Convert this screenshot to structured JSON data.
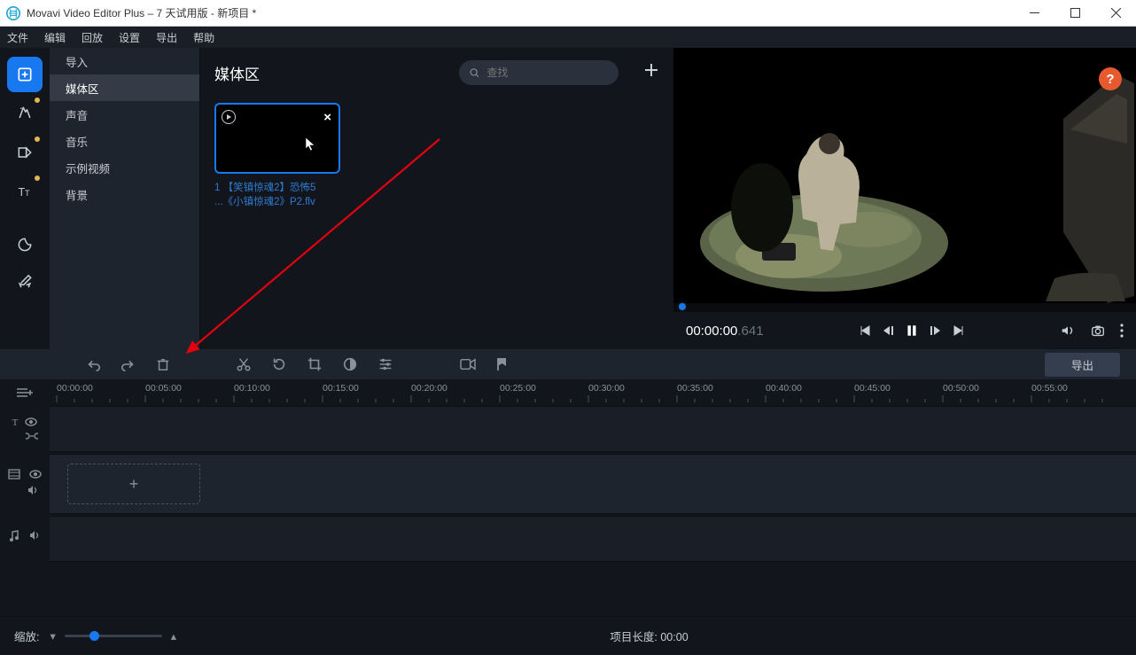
{
  "window": {
    "title": "Movavi Video Editor Plus – 7 天试用版 - 新项目 *"
  },
  "menu": {
    "file": "文件",
    "edit": "编辑",
    "playback": "回放",
    "settings": "设置",
    "export": "导出",
    "help": "帮助"
  },
  "side": {
    "import": "导入",
    "media": "媒体区",
    "sound": "声音",
    "music": "音乐",
    "sample": "示例视频",
    "bg": "背景"
  },
  "media": {
    "title": "媒体区",
    "search_placeholder": "查找",
    "clip_line1": "1 【笑镇惊魂2】恐怖5",
    "clip_line2": "...《小镇惊魂2》P2.flv"
  },
  "help_btn": "?",
  "preview": {
    "timecode_main": "00:00:00",
    "timecode_ms": ".641"
  },
  "toolbar": {
    "export_label": "导出"
  },
  "ruler": [
    "00:00:00",
    "00:05:00",
    "00:10:00",
    "00:15:00",
    "00:20:00",
    "00:25:00",
    "00:30:00",
    "00:35:00",
    "00:40:00",
    "00:45:00",
    "00:50:00",
    "00:55:00"
  ],
  "status": {
    "zoom_label": "缩放:",
    "project_len_label": "项目长度:",
    "project_len_value": "00:00"
  },
  "drop": {
    "plus": "+"
  }
}
